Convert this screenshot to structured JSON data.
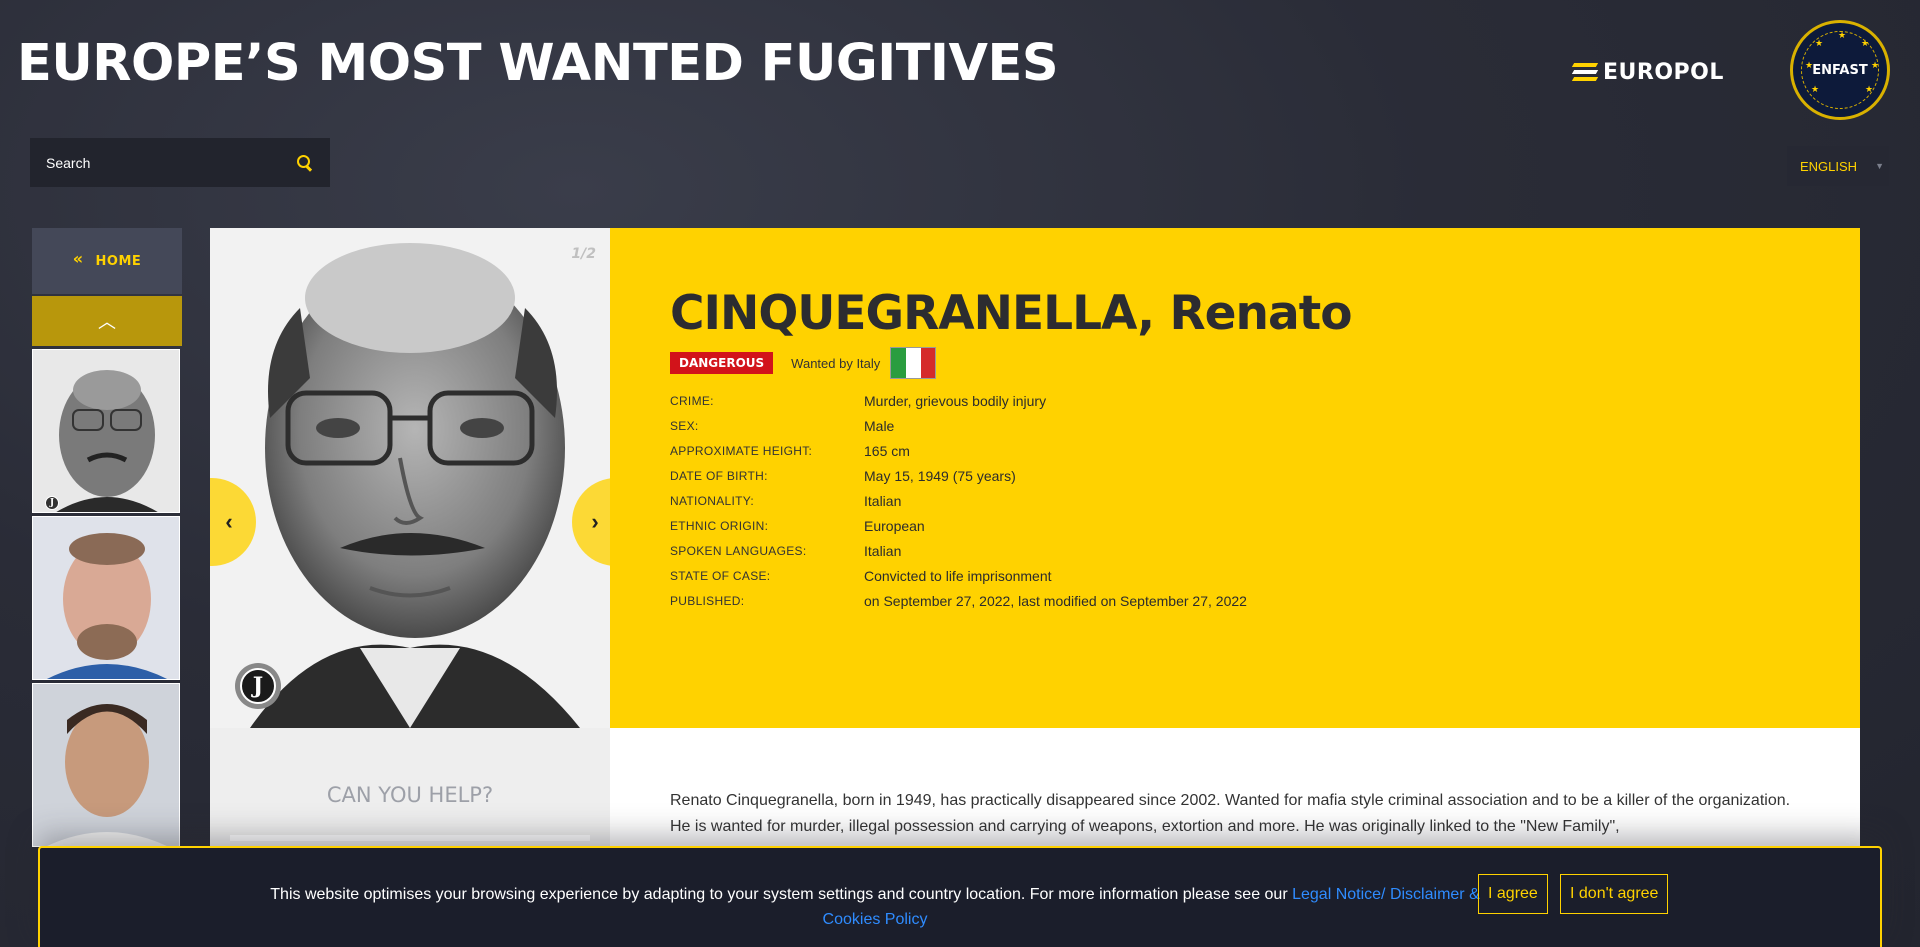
{
  "header": {
    "title": "EUROPE’S MOST WANTED FUGITIVES",
    "europol_logo": "EUROPOL",
    "enfast_logo": "ENFAST"
  },
  "search": {
    "placeholder": "Search"
  },
  "language": {
    "selected": "ENGLISH"
  },
  "sidebar": {
    "home_label": "HOME",
    "home_icon": "double-chevron-left-icon",
    "up_icon": "chevron-up-icon"
  },
  "photo": {
    "counter": "1/2",
    "prev": "‹",
    "next": "›",
    "badge": "J"
  },
  "fugitive": {
    "name": "CINQUEGRANELLA, Renato",
    "danger_badge": "DANGEROUS",
    "wanted_by": "Wanted by Italy",
    "flag_colors": [
      "#2a9d3f",
      "#ffffff",
      "#d52b2b"
    ],
    "details": [
      {
        "label": "CRIME:",
        "value": "Murder, grievous bodily injury"
      },
      {
        "label": "SEX:",
        "value": "Male"
      },
      {
        "label": "APPROXIMATE HEIGHT:",
        "value": "165 cm"
      },
      {
        "label": "DATE OF BIRTH:",
        "value": "May 15, 1949 (75 years)"
      },
      {
        "label": "NATIONALITY:",
        "value": "Italian"
      },
      {
        "label": "ETHNIC ORIGIN:",
        "value": "European"
      },
      {
        "label": "SPOKEN LANGUAGES:",
        "value": "Italian"
      },
      {
        "label": "STATE OF CASE:",
        "value": "Convicted to life imprisonment"
      },
      {
        "label": "PUBLISHED:",
        "value": "on September 27, 2022, last modified on September 27, 2022"
      }
    ],
    "description": "Renato Cinquegranella, born in 1949, has practically disappeared since 2002. Wanted for mafia style criminal association and to be a killer of the organization. He is wanted for murder, illegal possession and carrying of weapons, extortion and more. He was originally linked to the \"New Family\","
  },
  "help": {
    "title": "CAN YOU HELP?"
  },
  "cookie": {
    "text": "This website optimises your browsing experience by adapting to your system settings and country location. For more information please see our ",
    "link": "Legal Notice/ Disclaimer & Cookies Policy",
    "agree": "I agree",
    "disagree": "I don't agree"
  },
  "colors": {
    "accent": "#ffd200",
    "danger": "#d2131a",
    "background": "#2b2e3a"
  }
}
